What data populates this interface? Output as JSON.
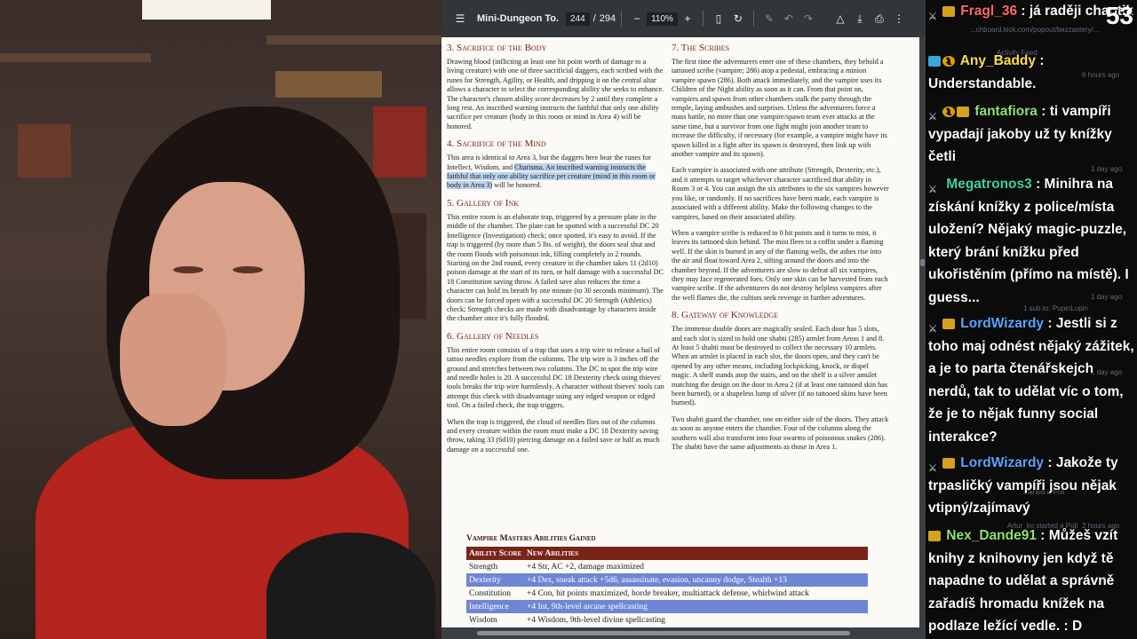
{
  "viewer": {
    "doc_title": "Mini-Dungeon To...",
    "page_current": "244",
    "page_sep": "/",
    "page_total": "294",
    "zoom": "110%"
  },
  "document": {
    "left": [
      {
        "heading": "3. Sacrifice of the Body",
        "paras": [
          {
            "pre": "Drawing blood (inflicting at least one hit point worth of damage to a living creature) with one of three sacrificial daggers, each scribed with the runes for Strength, Agility, or Health, and dripping it on the central altar allows a character to select the corresponding ability she seeks to enhance. The character's chosen ability score decreases by 2 until they complete a long rest. An inscribed warning instructs the faithful that only one ability sacrifice per creature (body in this room or mind in Area 4) will be honored.",
            "hl": "",
            "post": ""
          }
        ]
      },
      {
        "heading": "4. Sacrifice of the Mind",
        "paras": [
          {
            "pre": "This area is identical to Area 3, but the daggers here bear the runes for Intellect, Wisdom, and ",
            "hl": "Charisma. An inscribed warning instructs the faithful that only one ability sacrifice per creature (mind in this room or body in Area 3)",
            "post": " will be honored."
          }
        ]
      },
      {
        "heading": "5. Gallery of Ink",
        "paras": [
          {
            "pre": "This entire room is an elaborate trap, triggered by a pressure plate in the middle of the chamber. The plate can be spotted with a successful DC 20 Intelligence (Investigation) check; once spotted, it's easy to avoid. If the trap is triggered (by more than 5 lbs. of weight), the doors seal shut and the room floods with poisonous ink, filling completely in 2 rounds. Starting on the 2nd round, every creature in the chamber takes 11 (2d10) poison damage at the start of its turn, or half damage with a successful DC 18 Constitution saving throw. A failed save also reduces the time a character can hold its breath by one minute (to 30 seconds minimum). The doors can be forced open with a successful DC 20 Strength (Athletics) check; Strength checks are made with disadvantage by characters inside the chamber once it's fully flooded.",
            "hl": "",
            "post": ""
          }
        ]
      },
      {
        "heading": "6. Gallery of Needles",
        "paras": [
          {
            "pre": "This entire room consists of a trap that uses a trip wire to release a hail of tattoo needles explore from the columns. The trip wire is 3 inches off the ground and stretches between two columns. The DC to spot the trip wire and needle holes is 20. A successful DC 18 Dexterity check using thieves' tools breaks the trip wire harmlessly. A character without thieves' tools can attempt this check with disadvantage using any edged weapon or edged tool. On a failed check, the trap triggers.",
            "hl": "",
            "post": ""
          },
          {
            "pre": "When the trap is triggered, the cloud of needles flies out of the columns and every creature within the room must make a DC 18 Dexterity saving throw, taking 33 (6d10) piercing damage on a failed save or half as much damage on a successful one.",
            "hl": "",
            "post": ""
          }
        ]
      }
    ],
    "right": [
      {
        "heading": "7. The Scribes",
        "paras": [
          {
            "pre": "The first time the adventurers enter one of these chambers, they behold a tattooed scribe (vampire; 286) atop a pedestal, embracing a minion vampire spawn (286). Both attack immediately, and the vampire uses its Children of the Night ability as soon as it can. From that point on, vampires and spawn from other chambers stalk the party through the temple, laying ambushes and surprises. Unless the adventurers force a mass battle, no more than one vampire/spawn team ever attacks at the same time, but a survivor from one fight might join another team to increase the difficulty, if necessary (for example, a vampire might have its spawn killed in a fight after its spawn is destroyed, then link up with another vampire and its spawn).",
            "hl": "",
            "post": ""
          },
          {
            "pre": "Each vampire is associated with one attribute (Strength, Dexterity, etc.), and it attempts to target whichever character sacrificed that ability in Room 3 or 4. You can assign the six attributes to the six vampires however you like, or randomly. If no sacrifices have been made, each vampire is associated with a different ability. Make the following changes to the vampires, based on their associated ability.",
            "hl": "",
            "post": ""
          },
          {
            "pre": "When a vampire scribe is reduced to 0 hit points and it turns to mist, it leaves its tattooed skin behind. The mist flees to a coffin under a flaming well. If the skin is burned in any of the flaming wells, the ashes rise into the air and float toward Area 2, sifting around the doors and into the chamber beyond. If the adventurers are slow to defeat all six vampires, they may face regenerated foes. Only one skin can be harvested from each vampire scribe. If the adventurers do not destroy helpless vampires after the well flames die, the cultists seek revenge in further adventures.",
            "hl": "",
            "post": ""
          }
        ]
      },
      {
        "heading": "8. Gateway of Knowledge",
        "paras": [
          {
            "pre": "The immense double doors are magically sealed. Each door has 5 slots, and each slot is sized to hold one shabti (285) armlet from Areas 1 and 8. At least 5 shabti must be destroyed to collect the necessary 10 armlets. When an armlet is placed in each slot, the doors open, and they can't be opened by any other means, including lockpicking, knock, or dispel magic. A shelf stands atop the stairs, and on the shelf is a silver amulet matching the design on the door to Area 2 (if at least one tattooed skin has been burned), or a shapeless lump of silver (if no tattooed skins have been burned).",
            "hl": "",
            "post": ""
          },
          {
            "pre": "Two shabti guard the chamber, one on either side of the doors. They attack as soon as anyone enters the chamber. Four of the columns along the southern wall also transform into four swarms of poisonous snakes (286). The shabti have the same adjustments as those in Area 1.",
            "hl": "",
            "post": ""
          }
        ]
      }
    ],
    "table": {
      "caption": "Vampire Masters Abilities Gained",
      "headers": [
        "Ability Score",
        "New Abilities"
      ],
      "rows": [
        [
          "Strength",
          "+4 Str, AC +2, damage maximized"
        ],
        [
          "Dexterity",
          "+4 Dex, sneak attack +5d6, assassinate, evasion, uncanny dodge, Stealth +13"
        ],
        [
          "Constitution",
          "+4 Con, hit points maximized, horde breaker, multiattack defense, whirlwind attack"
        ],
        [
          "Intelligence",
          "+4 Int, 9th-level arcane spellcasting"
        ],
        [
          "Wisdom",
          "+4 Wisdom, 9th-level divine spellcasting"
        ]
      ]
    }
  },
  "chat": {
    "counter": "53",
    "messages": [
      {
        "user": "Fragl_36",
        "color": "#ff6b6b",
        "badges": [
          "sword",
          "crown"
        ],
        "text": ": já raději chaotik"
      },
      {
        "user": "Any_Baddy",
        "color": "#ffe04a",
        "badges": [
          "sub",
          "one"
        ],
        "text": ": Understandable."
      },
      {
        "user": "fantafiora",
        "color": "#8fe36b",
        "badges": [
          "sword",
          "one",
          "crown"
        ],
        "text": ": ti vampíři vypadají jakoby už ty knížky četli"
      },
      {
        "user": "Megatronos3",
        "color": "#3fd6a0",
        "badges": [
          "sword"
        ],
        "text": ": Minihra na získání knížky z police/místa uložení? Nějaký magic-puzzle, který brání knížku před ukořistěním (přímo na místě). I guess..."
      },
      {
        "user": "LordWizardy",
        "color": "#5aa7ff",
        "badges": [
          "sword",
          "crown"
        ],
        "text": ": Jestli si z toho maj odnést nějaký zážitek, a je to parta čtenářskejch nerdů, tak to udělat víc o tom, že je to nějak funny social interakce?"
      },
      {
        "user": "LordWizardy",
        "color": "#5aa7ff",
        "badges": [
          "sword",
          "crown"
        ],
        "text": ": Jakože ty trpasličký vampíři jsou nějak vtipný/zajímavý"
      },
      {
        "user": "Nex_Dande91",
        "color": "#8fe36b",
        "badges": [
          "crown"
        ],
        "text": ": Můžeš vzít knihy z knihovny jen když tě napadne to udělat a správně zařadíš hromadu knížek na podlaze ležící vedle. : D"
      }
    ],
    "ghost": [
      "...chboard.kick.com/popout/bezzastery/...",
      "Activity Feed",
      "6 hours ago",
      "1 day ago",
      "1 day ago",
      "1 sub to: PupinLupin",
      "1 day ago",
      "started a Poll",
      "2 hours ago",
      "Artur_ko started a Poll"
    ]
  }
}
